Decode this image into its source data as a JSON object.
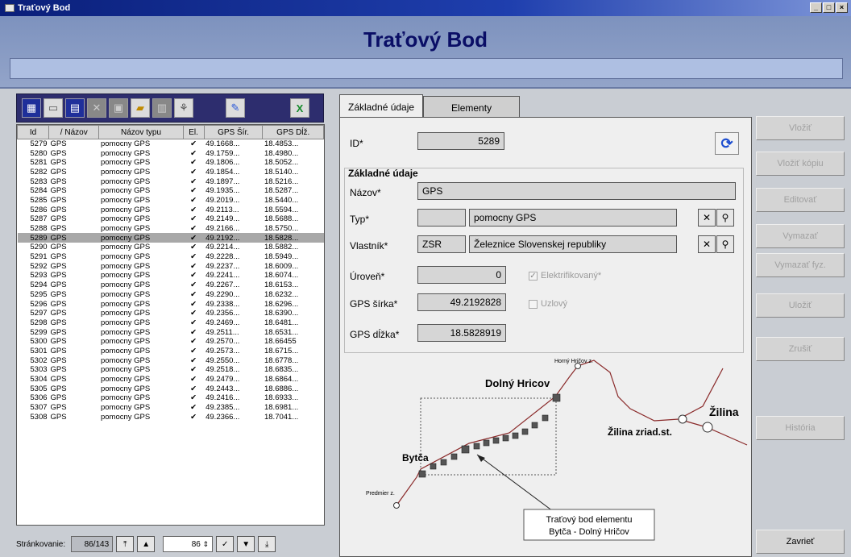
{
  "window": {
    "title": "Traťový Bod"
  },
  "header": {
    "title": "Traťový Bod"
  },
  "grid": {
    "columns": [
      "Id",
      "/ Názov",
      "Názov typu",
      "El.",
      "GPS Šír.",
      "GPS Dĺž."
    ],
    "selected_index": 10,
    "rows": [
      [
        "5279",
        "GPS",
        "pomocny GPS",
        "✔",
        "49.1668...",
        "18.4853..."
      ],
      [
        "5280",
        "GPS",
        "pomocny GPS",
        "✔",
        "49.1759...",
        "18.4980..."
      ],
      [
        "5281",
        "GPS",
        "pomocny GPS",
        "✔",
        "49.1806...",
        "18.5052..."
      ],
      [
        "5282",
        "GPS",
        "pomocny GPS",
        "✔",
        "49.1854...",
        "18.5140..."
      ],
      [
        "5283",
        "GPS",
        "pomocny GPS",
        "✔",
        "49.1897...",
        "18.5216..."
      ],
      [
        "5284",
        "GPS",
        "pomocny GPS",
        "✔",
        "49.1935...",
        "18.5287..."
      ],
      [
        "5285",
        "GPS",
        "pomocny GPS",
        "✔",
        "49.2019...",
        "18.5440..."
      ],
      [
        "5286",
        "GPS",
        "pomocny GPS",
        "✔",
        "49.2113...",
        "18.5594..."
      ],
      [
        "5287",
        "GPS",
        "pomocny GPS",
        "✔",
        "49.2149...",
        "18.5688..."
      ],
      [
        "5288",
        "GPS",
        "pomocny GPS",
        "✔",
        "49.2166...",
        "18.5750..."
      ],
      [
        "5289",
        "GPS",
        "pomocny GPS",
        "✔",
        "49.2192...",
        "18.5828..."
      ],
      [
        "5290",
        "GPS",
        "pomocny GPS",
        "✔",
        "49.2214...",
        "18.5882..."
      ],
      [
        "5291",
        "GPS",
        "pomocny GPS",
        "✔",
        "49.2228...",
        "18.5949..."
      ],
      [
        "5292",
        "GPS",
        "pomocny GPS",
        "✔",
        "49.2237...",
        "18.6009..."
      ],
      [
        "5293",
        "GPS",
        "pomocny GPS",
        "✔",
        "49.2241...",
        "18.6074..."
      ],
      [
        "5294",
        "GPS",
        "pomocny GPS",
        "✔",
        "49.2267...",
        "18.6153..."
      ],
      [
        "5295",
        "GPS",
        "pomocny GPS",
        "✔",
        "49.2290...",
        "18.6232..."
      ],
      [
        "5296",
        "GPS",
        "pomocny GPS",
        "✔",
        "49.2338...",
        "18.6296..."
      ],
      [
        "5297",
        "GPS",
        "pomocny GPS",
        "✔",
        "49.2356...",
        "18.6390..."
      ],
      [
        "5298",
        "GPS",
        "pomocny GPS",
        "✔",
        "49.2469...",
        "18.6481..."
      ],
      [
        "5299",
        "GPS",
        "pomocny GPS",
        "✔",
        "49.2511...",
        "18.6531..."
      ],
      [
        "5300",
        "GPS",
        "pomocny GPS",
        "✔",
        "49.2570...",
        "18.66455"
      ],
      [
        "5301",
        "GPS",
        "pomocny GPS",
        "✔",
        "49.2573...",
        "18.6715..."
      ],
      [
        "5302",
        "GPS",
        "pomocny GPS",
        "✔",
        "49.2550...",
        "18.6778..."
      ],
      [
        "5303",
        "GPS",
        "pomocny GPS",
        "✔",
        "49.2518...",
        "18.6835..."
      ],
      [
        "5304",
        "GPS",
        "pomocny GPS",
        "✔",
        "49.2479...",
        "18.6864..."
      ],
      [
        "5305",
        "GPS",
        "pomocny GPS",
        "✔",
        "49.2443...",
        "18.6886..."
      ],
      [
        "5306",
        "GPS",
        "pomocny GPS",
        "✔",
        "49.2416...",
        "18.6933..."
      ],
      [
        "5307",
        "GPS",
        "pomocny GPS",
        "✔",
        "49.2385...",
        "18.6981..."
      ],
      [
        "5308",
        "GPS",
        "pomocny GPS",
        "✔",
        "49.2366...",
        "18.7041..."
      ]
    ]
  },
  "pager": {
    "label": "Stránkovanie:",
    "position": "86/143",
    "page_size": "86"
  },
  "tabs": [
    {
      "label": "Základné údaje"
    },
    {
      "label": "Elementy"
    }
  ],
  "form": {
    "id_label": "ID*",
    "id_value": "5289",
    "group_title": "Základné údaje",
    "nazov_label": "Názov*",
    "nazov_value": "GPS",
    "typ_label": "Typ*",
    "typ_code": "",
    "typ_value": "pomocny GPS",
    "vlastnik_label": "Vlastník*",
    "vlastnik_code": "ZSR",
    "vlastnik_value": "Železnice Slovenskej republiky",
    "uroven_label": "Úroveň*",
    "uroven_value": "0",
    "elektrifikovany_label": "Elektrifikovaný*",
    "elektrifikovany_checked": true,
    "uzlovy_label": "Uzlový",
    "uzlovy_checked": false,
    "sirka_label": "GPS šírka*",
    "sirka_value": "49.2192828",
    "dlzka_label": "GPS dĺžka*",
    "dlzka_value": "18.5828919"
  },
  "map": {
    "labels": {
      "horny_hricov": "Horný Hričov z.",
      "dolny_hricov": "Dolný Hricov",
      "zilina": "Žilina",
      "zilina_zriad": "Žilina zriad.st.",
      "bytca": "Bytča",
      "predmier": "Predmier z.",
      "callout_line1": "Traťový bod elementu",
      "callout_line2": "Bytča - Dolný Hričov"
    }
  },
  "actions": {
    "vlozit": "Vložiť",
    "vlozit_kopiu": "Vložiť kópiu",
    "editovat": "Editovať",
    "vymazat": "Vymazať",
    "vymazat_fyz": "Vymazať fyz.",
    "ulozit": "Uložiť",
    "zrusit": "Zrušiť",
    "historia": "História",
    "zavriet": "Zavrieť"
  }
}
